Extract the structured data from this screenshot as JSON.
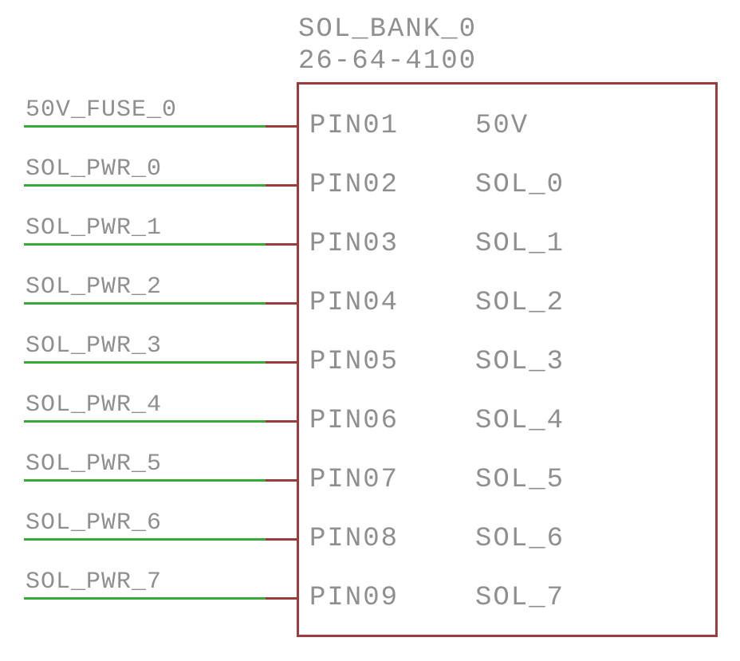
{
  "component": {
    "name": "SOL_BANK_0",
    "value": "26-64-4100"
  },
  "pins": [
    {
      "net": "50V_FUSE_0",
      "pin": "PIN01",
      "signal": "50V"
    },
    {
      "net": "SOL_PWR_0",
      "pin": "PIN02",
      "signal": "SOL_0"
    },
    {
      "net": "SOL_PWR_1",
      "pin": "PIN03",
      "signal": "SOL_1"
    },
    {
      "net": "SOL_PWR_2",
      "pin": "PIN04",
      "signal": "SOL_2"
    },
    {
      "net": "SOL_PWR_3",
      "pin": "PIN05",
      "signal": "SOL_3"
    },
    {
      "net": "SOL_PWR_4",
      "pin": "PIN06",
      "signal": "SOL_4"
    },
    {
      "net": "SOL_PWR_5",
      "pin": "PIN07",
      "signal": "SOL_5"
    },
    {
      "net": "SOL_PWR_6",
      "pin": "PIN08",
      "signal": "SOL_6"
    },
    {
      "net": "SOL_PWR_7",
      "pin": "PIN09",
      "signal": "SOL_7"
    }
  ]
}
